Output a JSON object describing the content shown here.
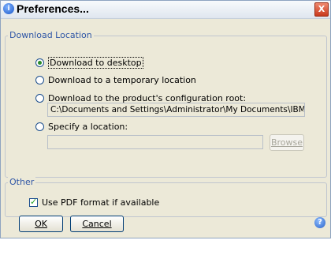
{
  "window": {
    "title": "Preferences...",
    "close_glyph": "X"
  },
  "download_group": {
    "legend": "Download Location",
    "options": [
      {
        "label": "Download to desktop",
        "checked": true
      },
      {
        "label": "Download to a temporary location",
        "checked": false
      },
      {
        "label": "Download to the product's configuration root:",
        "checked": false
      },
      {
        "label": "Specify a location:",
        "checked": false
      }
    ],
    "config_root_path": "C:\\Documents and Settings\\Administrator\\My Documents\\IBM\\iAccessClient\\Splf",
    "specify_location_value": "",
    "browse_label": "Browse"
  },
  "other_group": {
    "legend": "Other",
    "use_pdf_label": "Use PDF format if available",
    "use_pdf_checked": true
  },
  "buttons": {
    "ok_label": "OK",
    "cancel_label": "Cancel"
  },
  "icons": {
    "title_icon": "info-circle-icon",
    "help_icon": "help-question-icon"
  },
  "colors": {
    "legend_text": "#2f56a6",
    "dialog_bg": "#ece9d8",
    "close_button": "#d8532f"
  }
}
